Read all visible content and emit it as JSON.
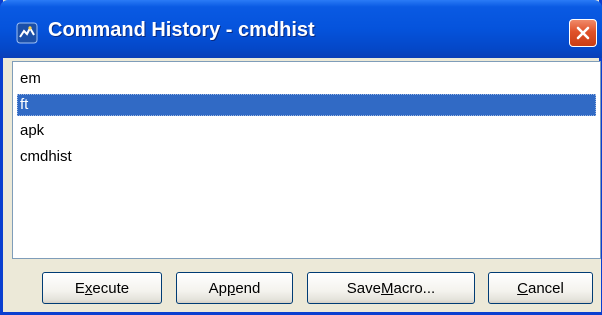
{
  "window": {
    "title": "Command History - cmdhist",
    "close_label": "Close"
  },
  "history": {
    "items": [
      "em",
      "ft",
      "apk",
      "cmdhist"
    ],
    "selected_index": 1
  },
  "buttons": {
    "execute": {
      "before": "E",
      "mnemonic": "x",
      "after": "ecute"
    },
    "append": {
      "before": "Ap",
      "mnemonic": "p",
      "after": "end"
    },
    "save_macro": {
      "before": "Save ",
      "mnemonic": "M",
      "after": "acro..."
    },
    "cancel": {
      "before": "",
      "mnemonic": "C",
      "after": "ancel"
    }
  },
  "colors": {
    "titlebar": "#0553dc",
    "selection": "#316ac5",
    "close_button": "#e0522a",
    "dialog_background": "#ece9d8"
  }
}
